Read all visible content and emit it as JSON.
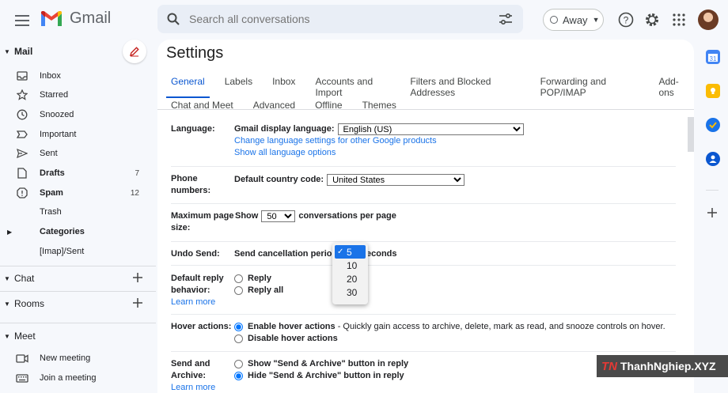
{
  "header": {
    "app_name": "Gmail",
    "search_placeholder": "Search all conversations",
    "status_label": "Away"
  },
  "sidebar": {
    "sections": {
      "mail": "Mail",
      "chat": "Chat",
      "rooms": "Rooms",
      "meet": "Meet"
    },
    "items": [
      {
        "label": "Inbox",
        "icon": "inbox-icon",
        "count": "",
        "bold": false
      },
      {
        "label": "Starred",
        "icon": "star-icon",
        "count": "",
        "bold": false
      },
      {
        "label": "Snoozed",
        "icon": "clock-icon",
        "count": "",
        "bold": false
      },
      {
        "label": "Important",
        "icon": "important-icon",
        "count": "",
        "bold": false
      },
      {
        "label": "Sent",
        "icon": "send-icon",
        "count": "",
        "bold": false
      },
      {
        "label": "Drafts",
        "icon": "draft-icon",
        "count": "7",
        "bold": true
      },
      {
        "label": "Spam",
        "icon": "spam-icon",
        "count": "12",
        "bold": true
      },
      {
        "label": "Trash",
        "icon": "trash-icon",
        "count": "",
        "bold": false
      },
      {
        "label": "Categories",
        "icon": "label-icon",
        "count": "",
        "bold": true
      },
      {
        "label": "[Imap]/Sent",
        "icon": "label-icon",
        "count": "",
        "bold": false
      }
    ],
    "meet_items": [
      {
        "label": "New meeting",
        "icon": "video-icon"
      },
      {
        "label": "Join a meeting",
        "icon": "keyboard-icon"
      }
    ]
  },
  "settings": {
    "title": "Settings",
    "tabs_row1": [
      "General",
      "Labels",
      "Inbox",
      "Accounts and Import",
      "Filters and Blocked Addresses",
      "Forwarding and POP/IMAP",
      "Add-ons"
    ],
    "tabs_row2": [
      "Chat and Meet",
      "Advanced",
      "Offline",
      "Themes"
    ],
    "language": {
      "label": "Language:",
      "display_label": "Gmail display language:",
      "selected": "English (US)",
      "change_link": "Change language settings for other Google products",
      "show_all_link": "Show all language options"
    },
    "phone": {
      "label": "Phone numbers:",
      "country_label": "Default country code:",
      "selected": "United States"
    },
    "page_size": {
      "label": "Maximum page size:",
      "show": "Show",
      "selected": "50",
      "suffix": "conversations per page"
    },
    "undo": {
      "label": "Undo Send:",
      "prefix": "Send cancellation period",
      "suffix": "econds",
      "options": [
        "5",
        "10",
        "20",
        "30"
      ]
    },
    "reply": {
      "label": "Default reply behavior:",
      "learn_more": "Learn more",
      "options": [
        "Reply",
        "Reply all"
      ]
    },
    "hover": {
      "label": "Hover actions:",
      "enable": "Enable hover actions",
      "enable_desc": " - Quickly gain access to archive, delete, mark as read, and snooze controls on hover.",
      "disable": "Disable hover actions"
    },
    "send_archive": {
      "label": "Send and Archive:",
      "learn_more": "Learn more",
      "options": [
        "Show \"Send & Archive\" button in reply",
        "Hide \"Send & Archive\" button in reply"
      ]
    }
  },
  "watermark": {
    "logo": "TN",
    "text": "ThanhNghiep.XYZ"
  }
}
